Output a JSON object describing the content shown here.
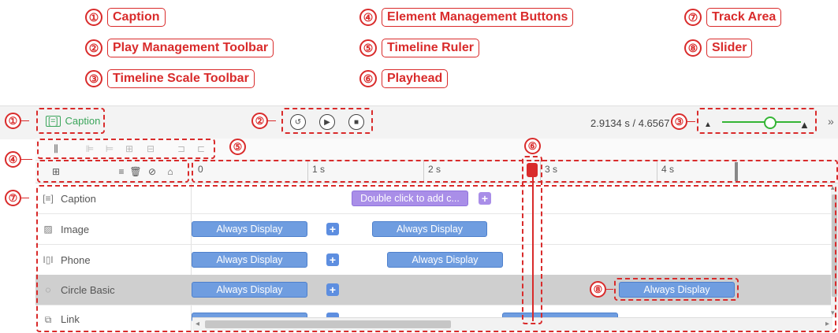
{
  "legend": [
    {
      "num": "①",
      "label": "Caption"
    },
    {
      "num": "②",
      "label": "Play Management Toolbar"
    },
    {
      "num": "③",
      "label": "Timeline Scale Toolbar"
    },
    {
      "num": "④",
      "label": "Element Management Buttons"
    },
    {
      "num": "⑤",
      "label": "Timeline Ruler"
    },
    {
      "num": "⑥",
      "label": "Playhead"
    },
    {
      "num": "⑦",
      "label": "Track Area"
    },
    {
      "num": "⑧",
      "label": "Slider"
    }
  ],
  "callouts": {
    "c1": "①",
    "c2": "②",
    "c3": "③",
    "c4": "④",
    "c5": "⑤",
    "c6": "⑥",
    "c7": "⑦",
    "c8": "⑧"
  },
  "header": {
    "caption_label": "Caption",
    "time_display": "2.9134 s / 4.6567 s"
  },
  "ruler": {
    "ticks": [
      "0",
      "1 s",
      "2 s",
      "3 s",
      "4 s"
    ]
  },
  "tracks": [
    {
      "name": "Caption",
      "icon": "caption-icon"
    },
    {
      "name": "Image",
      "icon": "image-icon"
    },
    {
      "name": "Phone",
      "icon": "phone-icon"
    },
    {
      "name": "Circle Basic",
      "icon": "circle-basic-icon"
    },
    {
      "name": "Link",
      "icon": "link-icon"
    }
  ],
  "clips": {
    "caption_hint": "Double click to add c...",
    "always": "Always Display",
    "plus": "+"
  },
  "colors": {
    "annotation": "#d92b2b",
    "clip": "#6f9de0",
    "caption_clip": "#a98ee8",
    "slider": "#35b535"
  }
}
